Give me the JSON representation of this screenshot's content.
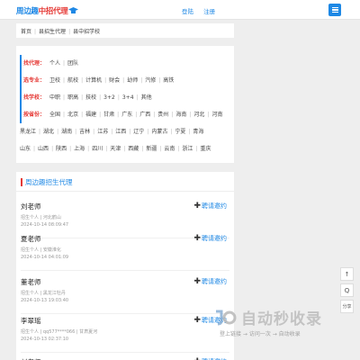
{
  "header": {
    "logo_prefix": "周边趣",
    "logo_highlight": "中招代理",
    "links": [
      "登陆",
      "注册"
    ]
  },
  "breadcrumb": [
    "首页",
    "县招生代理",
    "县中招学校"
  ],
  "filters": {
    "row1": {
      "label": "找代理：",
      "items": [
        "个人",
        "团队"
      ]
    },
    "row2": {
      "label": "选专业：",
      "items": [
        "卫校",
        "航校",
        "计算机",
        "财会",
        "幼师",
        "汽修",
        "高铁"
      ]
    },
    "row3": {
      "label": "找学校：",
      "items": [
        "中职",
        "职高",
        "技校",
        "3+2",
        "3+4",
        "其他"
      ]
    },
    "row4": {
      "label": "按省份：",
      "items": [
        "全国",
        "北京",
        "福建",
        "甘肃",
        "广东",
        "广西",
        "贵州",
        "海南",
        "河北",
        "河南"
      ]
    },
    "row5": {
      "items": [
        "黑龙江",
        "湖北",
        "湖南",
        "吉林",
        "江苏",
        "江西",
        "辽宁",
        "内蒙古",
        "宁夏",
        "青海"
      ]
    },
    "row6": {
      "items": [
        "山东",
        "山西",
        "陕西",
        "上海",
        "四川",
        "天津",
        "西藏",
        "新疆",
        "云南",
        "浙江",
        "重庆"
      ]
    }
  },
  "list": {
    "title": "周边趣招生代理",
    "invite_label": "聘请邀约",
    "items": [
      {
        "name": "刘老师",
        "meta": "招生个人 | 河北鹤山",
        "date": "2024-10-14 08:09:47"
      },
      {
        "name": "夏老师",
        "meta": "招生个人 | 安徽淮化",
        "date": "2024-10-14 04:01:09"
      },
      {
        "name": "董老师",
        "meta": "招生个人 | 黑龙江牡丹",
        "date": "2024-10-13 19:03:40"
      },
      {
        "name": "李翠瑶",
        "meta": "招生个人 | qq577****066 | 甘肃夏河",
        "date": "2024-10-13 02:37:10"
      },
      {
        "name": "刘老师",
        "meta": "",
        "date": ""
      }
    ]
  },
  "side_tools": [
    "↑",
    "Q",
    "分享"
  ],
  "watermark": {
    "main": "自动秒收录",
    "sub": "登上链接 → 访问一次 → 自动收录"
  },
  "colors": {
    "accent": "#1e88e5",
    "highlight": "#e53935"
  }
}
